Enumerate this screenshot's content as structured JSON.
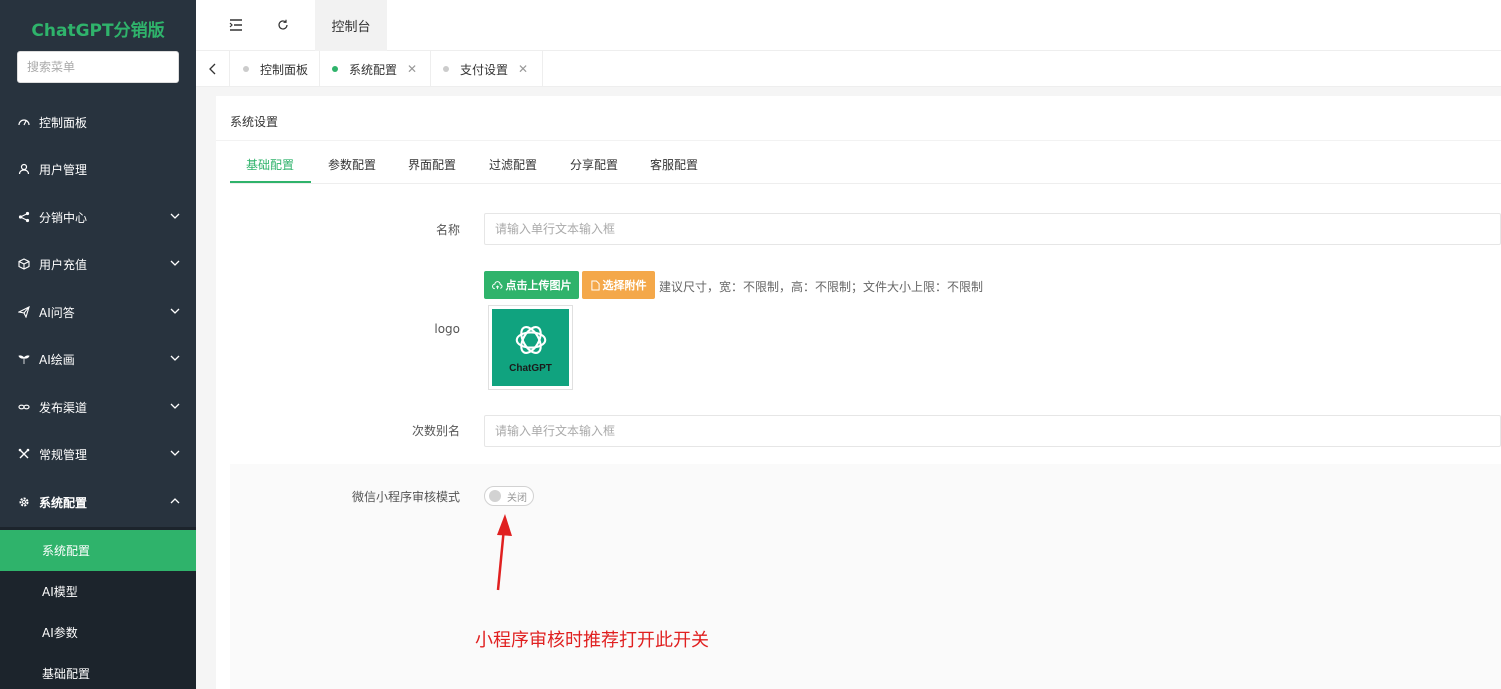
{
  "app": {
    "title": "ChatGPT分销版"
  },
  "sidebar": {
    "search_placeholder": "搜索菜单",
    "items": [
      {
        "label": "控制面板",
        "icon": "dashboard-icon",
        "chevron": ""
      },
      {
        "label": "用户管理",
        "icon": "user-icon",
        "chevron": ""
      },
      {
        "label": "分销中心",
        "icon": "share-icon",
        "chevron": "down"
      },
      {
        "label": "用户充值",
        "icon": "box-icon",
        "chevron": "down"
      },
      {
        "label": "AI问答",
        "icon": "send-icon",
        "chevron": "down"
      },
      {
        "label": "AI绘画",
        "icon": "plant-icon",
        "chevron": "down"
      },
      {
        "label": "发布渠道",
        "icon": "link-icon",
        "chevron": "down"
      },
      {
        "label": "常规管理",
        "icon": "tools-icon",
        "chevron": "down"
      },
      {
        "label": "系统配置",
        "icon": "gear-icon",
        "chevron": "up"
      }
    ],
    "submenu": [
      {
        "label": "系统配置",
        "active": true
      },
      {
        "label": "AI模型",
        "active": false
      },
      {
        "label": "AI参数",
        "active": false
      },
      {
        "label": "基础配置",
        "active": false
      }
    ]
  },
  "header": {
    "tab_label": "控制台"
  },
  "tabs": [
    {
      "label": "控制面板",
      "closable": false,
      "active": false
    },
    {
      "label": "系统配置",
      "closable": true,
      "active": true,
      "close": "✕"
    },
    {
      "label": "支付设置",
      "closable": true,
      "active": false,
      "close": "✕"
    }
  ],
  "card": {
    "title": "系统设置",
    "subtabs": [
      "基础配置",
      "参数配置",
      "界面配置",
      "过滤配置",
      "分享配置",
      "客服配置"
    ]
  },
  "form": {
    "name_label": "名称",
    "name_placeholder": "请输入单行文本输入框",
    "logo_label": "logo",
    "upload_button": "点击上传图片",
    "attach_button": "选择附件",
    "size_hint": "建议尺寸，宽：不限制，高：不限制；文件大小上限：不限制",
    "logo_brand": "ChatGPT",
    "alias_label": "次数别名",
    "alias_placeholder": "请输入单行文本输入框",
    "review_label": "微信小程序审核模式",
    "review_switch": "关闭",
    "review_switch_on": false
  },
  "annotation": {
    "text": "小程序审核时推荐打开此开关",
    "color": "#e02020"
  },
  "colors": {
    "accent": "#2fb36b",
    "sidebar": "#28333e",
    "attach": "#f4a84a",
    "logo_bg": "#10a37f"
  }
}
